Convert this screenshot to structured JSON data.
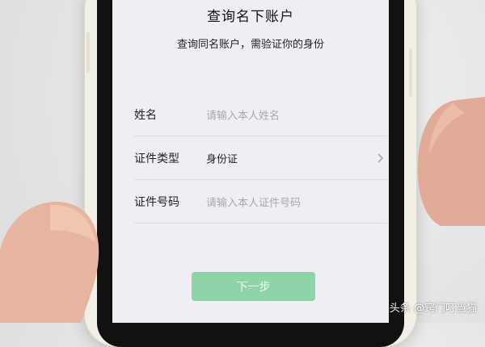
{
  "header": {
    "title": "查询名下账户",
    "subtitle": "查询同名账户，需验证你的身份"
  },
  "form": {
    "name_row": {
      "label": "姓名",
      "placeholder": "请输入本人姓名"
    },
    "id_type_row": {
      "label": "证件类型",
      "value": "身份证",
      "icon": "chevron-right-icon"
    },
    "id_number_row": {
      "label": "证件号码",
      "placeholder": "请输入本人证件号码"
    }
  },
  "actions": {
    "next_label": "下一步",
    "next_color": "#8fd3a9"
  },
  "watermark": {
    "text": "头条 @窍门叮当猫"
  }
}
